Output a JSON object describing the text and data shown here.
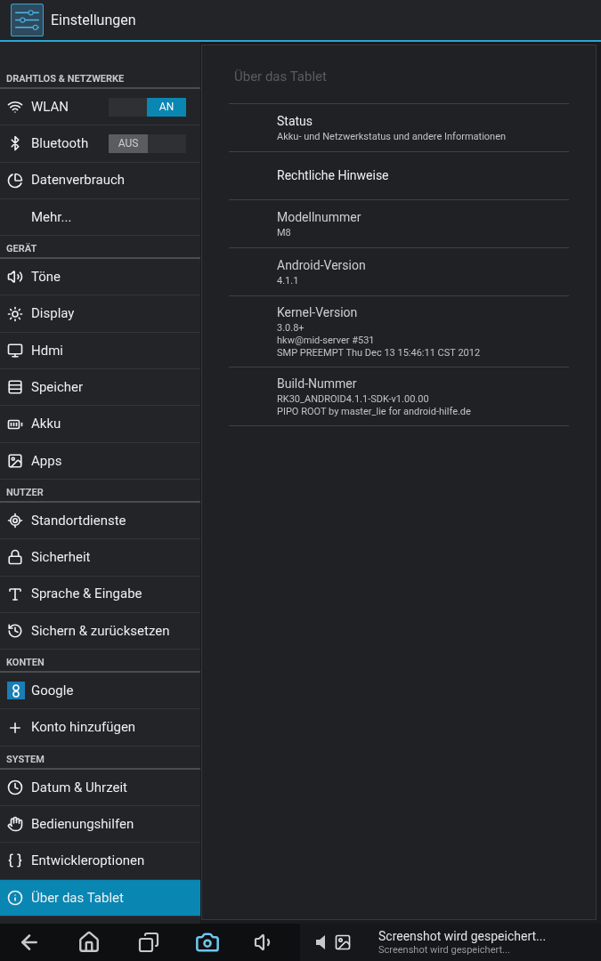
{
  "action_bar": {
    "title": "Einstellungen"
  },
  "sidebar": {
    "sections": [
      {
        "header": "DRAHTLOS & NETZWERKE",
        "items": [
          {
            "label": "WLAN",
            "selected": false,
            "toggle": {
              "label": "AN",
              "on": true
            }
          },
          {
            "label": "Bluetooth",
            "selected": false,
            "toggle": {
              "label": "AUS",
              "on": false
            }
          },
          {
            "label": "Datenverbrauch",
            "selected": false
          },
          {
            "label": "Mehr...",
            "selected": false
          }
        ]
      },
      {
        "header": "GERÄT",
        "items": [
          {
            "label": "Töne",
            "selected": false
          },
          {
            "label": "Display",
            "selected": false
          },
          {
            "label": "Hdmi",
            "selected": false
          },
          {
            "label": "Speicher",
            "selected": false
          },
          {
            "label": "Akku",
            "selected": false
          },
          {
            "label": "Apps",
            "selected": false
          }
        ]
      },
      {
        "header": "NUTZER",
        "items": [
          {
            "label": "Standortdienste",
            "selected": false
          },
          {
            "label": "Sicherheit",
            "selected": false
          },
          {
            "label": "Sprache & Eingabe",
            "selected": false
          },
          {
            "label": "Sichern & zurücksetzen",
            "selected": false
          }
        ]
      },
      {
        "header": "KONTEN",
        "items": [
          {
            "label": "Google",
            "selected": false
          },
          {
            "label": "Konto hinzufügen",
            "selected": false
          }
        ]
      },
      {
        "header": "SYSTEM",
        "items": [
          {
            "label": "Datum & Uhrzeit",
            "selected": false
          },
          {
            "label": "Bedienungshilfen",
            "selected": false
          },
          {
            "label": "Entwickleroptionen",
            "selected": false
          },
          {
            "label": "Über das Tablet",
            "selected": true
          }
        ]
      }
    ]
  },
  "detail": {
    "title": "Über das Tablet",
    "rows": [
      {
        "title": "Status",
        "lines": [
          "Akku- und Netzwerkstatus und andere Informationen"
        ],
        "kind": "link"
      },
      {
        "title": "Rechtliche Hinweise",
        "lines": [],
        "kind": "link"
      },
      {
        "title": "Modellnummer",
        "lines": [
          "M8"
        ],
        "kind": "info"
      },
      {
        "title": "Android-Version",
        "lines": [
          "4.1.1"
        ],
        "kind": "info"
      },
      {
        "title": "Kernel-Version",
        "lines": [
          "3.0.8+",
          "hkw@mid-server #531",
          "SMP PREEMPT Thu Dec 13 15:46:11 CST 2012"
        ],
        "kind": "info"
      },
      {
        "title": "Build-Nummer",
        "lines": [
          "RK30_ANDROID4.1.1-SDK-v1.00.00",
          "PIPO ROOT by master_lie for android-hilfe.de"
        ],
        "kind": "info"
      }
    ]
  },
  "notification": {
    "title": "Screenshot wird gespeichert...",
    "text": "Screenshot wird gespeichert..."
  }
}
